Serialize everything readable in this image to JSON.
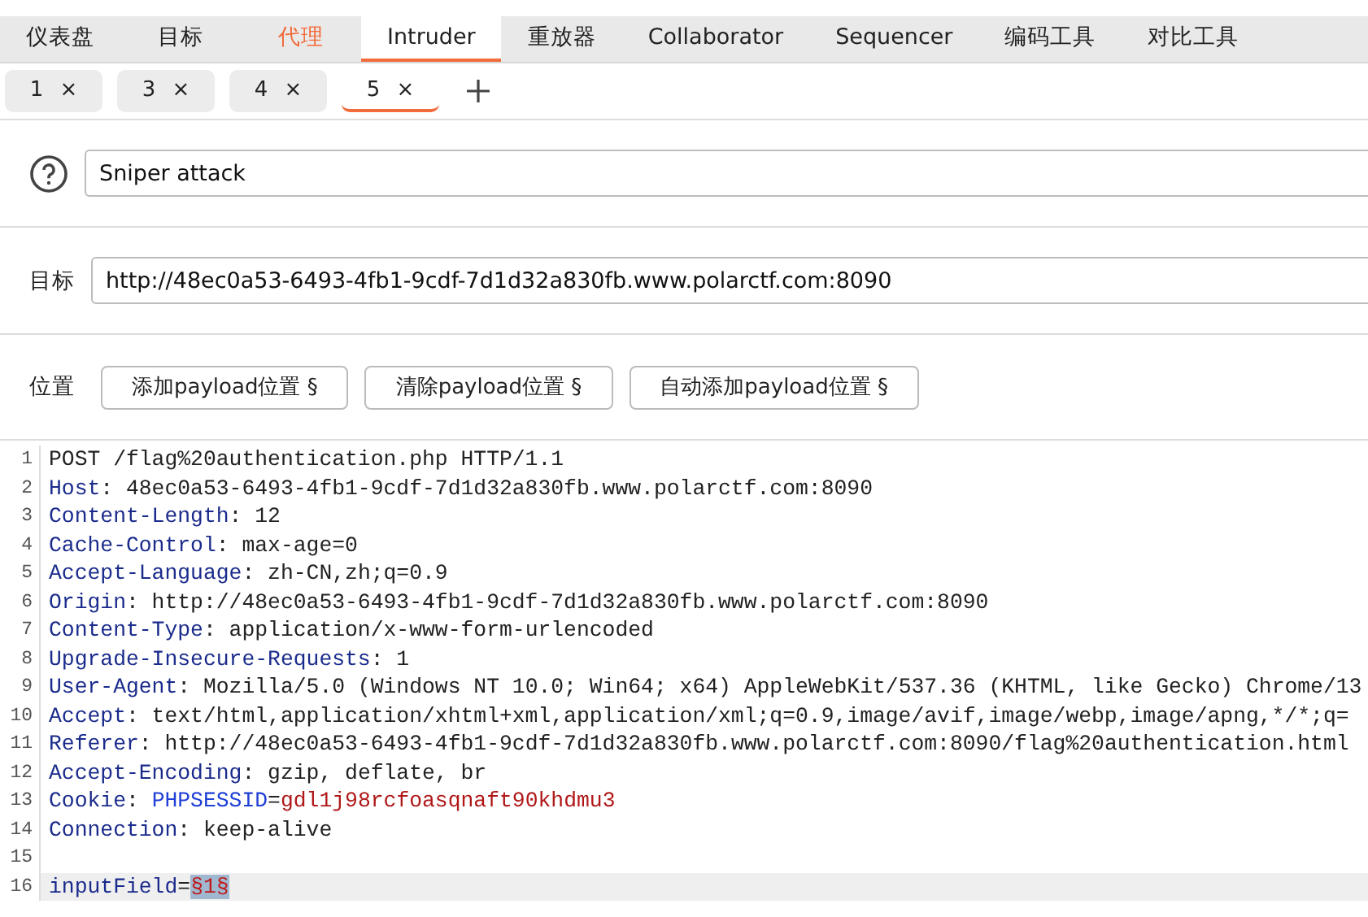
{
  "tabs": [
    {
      "label": "仪表盘",
      "selected": false,
      "highlighted": false
    },
    {
      "label": "目标",
      "selected": false,
      "highlighted": false
    },
    {
      "label": "代理",
      "selected": false,
      "highlighted": true
    },
    {
      "label": "Intruder",
      "selected": true,
      "highlighted": false
    },
    {
      "label": "重放器",
      "selected": false,
      "highlighted": false
    },
    {
      "label": "Collaborator",
      "selected": false,
      "highlighted": false
    },
    {
      "label": "Sequencer",
      "selected": false,
      "highlighted": false
    },
    {
      "label": "编码工具",
      "selected": false,
      "highlighted": false
    },
    {
      "label": "对比工具",
      "selected": false,
      "highlighted": false
    }
  ],
  "attack_tabs": [
    {
      "label": "1",
      "close": "×",
      "selected": false
    },
    {
      "label": "3",
      "close": "×",
      "selected": false
    },
    {
      "label": "4",
      "close": "×",
      "selected": false
    },
    {
      "label": "5",
      "close": "×",
      "selected": true
    }
  ],
  "attack_type": {
    "value": "Sniper attack"
  },
  "target": {
    "label": "目标",
    "value": "http://48ec0a53-6493-4fb1-9cdf-7d1d32a830fb.www.polarctf.com:8090"
  },
  "positions": {
    "label": "位置",
    "buttons": [
      "添加payload位置 §",
      "清除payload位置 §",
      "自动添加payload位置 §"
    ]
  },
  "editor": {
    "lines": [
      {
        "number": "1",
        "current": false,
        "segments": [
          {
            "kind": "plain",
            "text": "POST /flag%20authentication.php HTTP/1.1"
          }
        ]
      },
      {
        "number": "2",
        "current": false,
        "segments": [
          {
            "kind": "name",
            "text": "Host"
          },
          {
            "kind": "plain",
            "text": ": 48ec0a53-6493-4fb1-9cdf-7d1d32a830fb.www.polarctf.com:8090"
          }
        ]
      },
      {
        "number": "3",
        "current": false,
        "segments": [
          {
            "kind": "name",
            "text": "Content-Length"
          },
          {
            "kind": "plain",
            "text": ": 12"
          }
        ]
      },
      {
        "number": "4",
        "current": false,
        "segments": [
          {
            "kind": "name",
            "text": "Cache-Control"
          },
          {
            "kind": "plain",
            "text": ": max-age=0"
          }
        ]
      },
      {
        "number": "5",
        "current": false,
        "segments": [
          {
            "kind": "name",
            "text": "Accept-Language"
          },
          {
            "kind": "plain",
            "text": ": zh-CN,zh;q=0.9"
          }
        ]
      },
      {
        "number": "6",
        "current": false,
        "segments": [
          {
            "kind": "name",
            "text": "Origin"
          },
          {
            "kind": "plain",
            "text": ": http://48ec0a53-6493-4fb1-9cdf-7d1d32a830fb.www.polarctf.com:8090"
          }
        ]
      },
      {
        "number": "7",
        "current": false,
        "segments": [
          {
            "kind": "name",
            "text": "Content-Type"
          },
          {
            "kind": "plain",
            "text": ": application/x-www-form-urlencoded"
          }
        ]
      },
      {
        "number": "8",
        "current": false,
        "segments": [
          {
            "kind": "name",
            "text": "Upgrade-Insecure-Requests"
          },
          {
            "kind": "plain",
            "text": ": 1"
          }
        ]
      },
      {
        "number": "9",
        "current": false,
        "segments": [
          {
            "kind": "name",
            "text": "User-Agent"
          },
          {
            "kind": "plain",
            "text": ": Mozilla/5.0 (Windows NT 10.0; Win64; x64) AppleWebKit/537.36 (KHTML, like Gecko) Chrome/13"
          }
        ]
      },
      {
        "number": "10",
        "current": false,
        "segments": [
          {
            "kind": "name",
            "text": "Accept"
          },
          {
            "kind": "plain",
            "text": ": text/html,application/xhtml+xml,application/xml;q=0.9,image/avif,image/webp,image/apng,*/*;q="
          }
        ]
      },
      {
        "number": "11",
        "current": false,
        "segments": [
          {
            "kind": "name",
            "text": "Referer"
          },
          {
            "kind": "plain",
            "text": ": http://48ec0a53-6493-4fb1-9cdf-7d1d32a830fb.www.polarctf.com:8090/flag%20authentication.html"
          }
        ]
      },
      {
        "number": "12",
        "current": false,
        "segments": [
          {
            "kind": "name",
            "text": "Accept-Encoding"
          },
          {
            "kind": "plain",
            "text": ": gzip, deflate, br"
          }
        ]
      },
      {
        "number": "13",
        "current": false,
        "segments": [
          {
            "kind": "name",
            "text": "Cookie"
          },
          {
            "kind": "plain",
            "text": ": "
          },
          {
            "kind": "cookie_name",
            "text": "PHPSESSID"
          },
          {
            "kind": "plain",
            "text": "="
          },
          {
            "kind": "cookie_value",
            "text": "gdl1j98rcfoasqnaft90khdmu3"
          }
        ]
      },
      {
        "number": "14",
        "current": false,
        "segments": [
          {
            "kind": "name",
            "text": "Connection"
          },
          {
            "kind": "plain",
            "text": ": keep-alive"
          }
        ]
      },
      {
        "number": "15",
        "current": false
      },
      {
        "number": "16",
        "current": true,
        "segments": [
          {
            "kind": "name",
            "text": "inputField"
          },
          {
            "kind": "plain",
            "text": "="
          },
          {
            "kind": "marker",
            "text": "§1§",
            "selected": true
          }
        ]
      }
    ]
  }
}
